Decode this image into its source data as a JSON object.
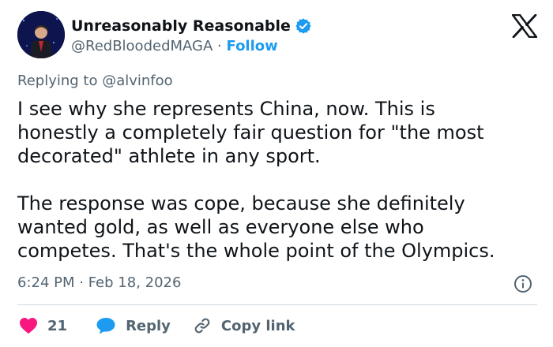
{
  "author": {
    "display_name": "Unreasonably Reasonable",
    "handle": "@RedBloodedMAGA",
    "separator": "·",
    "follow_label": "Follow"
  },
  "reply_context": {
    "prefix": "Replying to ",
    "mention": "@alvinfoo"
  },
  "tweet": {
    "text": "I see why she represents China, now. This is\nhonestly a completely fair question for \"the most\ndecorated\" athlete in any sport.\n\nThe response was cope, because she definitely\nwanted gold, as well as everyone else who\ncompetes. That's the whole point of the Olympics.",
    "timestamp": "6:24 PM · Feb 18, 2026"
  },
  "actions": {
    "like_count": "21",
    "reply_label": "Reply",
    "copy_link_label": "Copy link"
  },
  "icons": {
    "verified": "verified-badge-icon",
    "logo": "x-logo-icon",
    "info": "info-icon",
    "like": "heart-icon",
    "reply": "speech-bubble-icon",
    "copy": "link-icon"
  },
  "colors": {
    "accent": "#1d9bf0",
    "like": "#f91880",
    "secondary_text": "#536471",
    "primary_text": "#0f1419"
  }
}
